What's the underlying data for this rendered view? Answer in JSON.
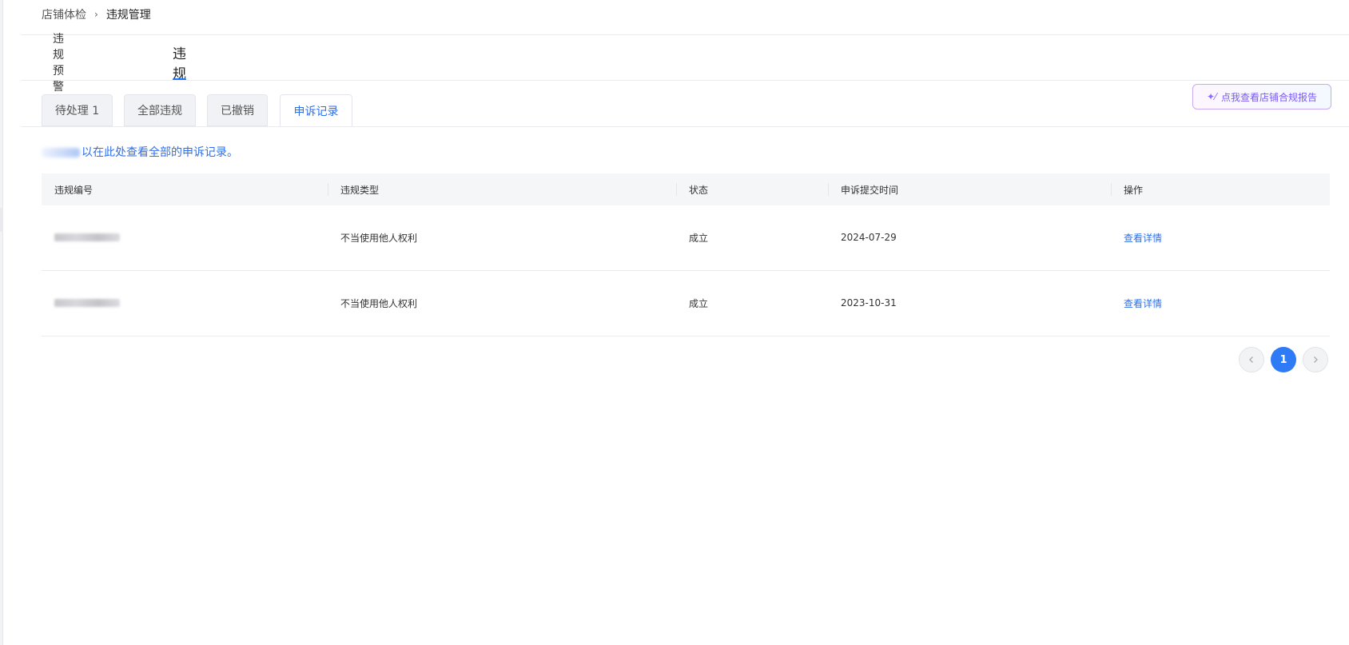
{
  "breadcrumb": {
    "parent": "店铺体检",
    "separator": "›",
    "current": "违规管理"
  },
  "main_tabs": [
    {
      "label": "违规预警",
      "active": false
    },
    {
      "label": "违规",
      "active": true
    }
  ],
  "sub_tabs": [
    {
      "label": "待处理 1",
      "active": false
    },
    {
      "label": "全部违规",
      "active": false
    },
    {
      "label": "已撤销",
      "active": false
    },
    {
      "label": "申诉记录",
      "active": true
    }
  ],
  "report_button": {
    "label": "点我查看店铺合规报告",
    "icon": "sparkle-pen-icon"
  },
  "notice": {
    "text": "以在此处查看全部的申诉记录。"
  },
  "table": {
    "headers": [
      "违规编号",
      "违规类型",
      "状态",
      "申诉提交时间",
      "操作"
    ],
    "rows": [
      {
        "id": "",
        "type": "不当使用他人权利",
        "status": "成立",
        "submitted": "2024-07-29",
        "action": "查看详情"
      },
      {
        "id": "",
        "type": "不当使用他人权利",
        "status": "成立",
        "submitted": "2023-10-31",
        "action": "查看详情"
      }
    ]
  },
  "pagination": {
    "prev_icon": "chevron-left-icon",
    "current_page": "1",
    "next_icon": "chevron-right-icon"
  },
  "colors": {
    "accent": "#2f6fe8",
    "tab_underline": "#1677ff",
    "header_bg": "#f5f6f8"
  }
}
